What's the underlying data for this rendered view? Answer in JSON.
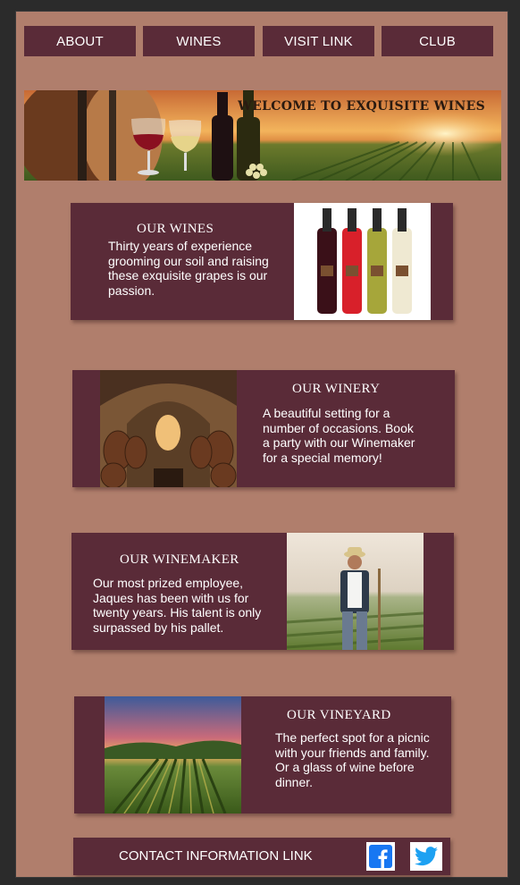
{
  "nav": {
    "items": [
      "ABOUT",
      "WINES",
      "VISIT LINK",
      "CLUB"
    ]
  },
  "banner": {
    "title": "WELCOME TO EXQUISITE WINES"
  },
  "sections": {
    "wines": {
      "title": "OUR WINES",
      "text": "Thirty years of experience grooming our soil and raising these exquisite grapes is our passion."
    },
    "winery": {
      "title": "OUR WINERY",
      "text": "A beautiful setting for a number of occasions. Book a party with our Winemaker for a special memory!"
    },
    "winemaker": {
      "title": "OUR WINEMAKER",
      "text": "Our most prized employee, Jaques has been with us for twenty years.  His talent is only surpassed by his pallet."
    },
    "vineyard": {
      "title": "OUR VINEYARD",
      "text": "The perfect spot for a picnic with your friends and family.  Or a glass of wine before dinner."
    }
  },
  "contact": {
    "label": "CONTACT INFORMATION LINK"
  },
  "icons": {
    "facebook": "facebook-icon",
    "twitter": "twitter-icon"
  },
  "colors": {
    "page_background": "#b07e6c",
    "card": "#5a2b38",
    "text": "#ffffff",
    "facebook": "#1877f2",
    "twitter": "#1da1f2"
  }
}
